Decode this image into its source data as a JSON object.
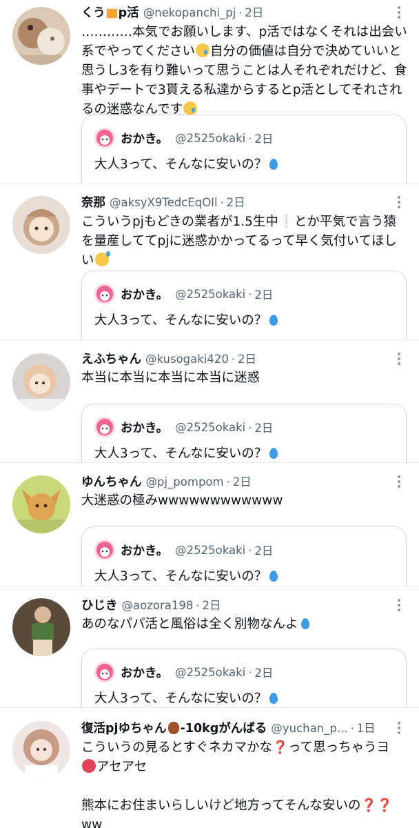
{
  "colors": {
    "text": "#0f1419",
    "secondary": "#536471",
    "divider": "#e6ecf0",
    "quote_border": "#cfd9de"
  },
  "icons": {
    "more": "more-vertical-icon",
    "drop": "droplet-emoji",
    "sad": "crying-face-emoji",
    "sweat": "grinning-sweat-emoji"
  },
  "quoted": {
    "name": "おかき。",
    "handle": "@2525okaki",
    "time": "2日",
    "text": "大人3って、そんなに安いの？"
  },
  "tweets": [
    {
      "name_a": "くう",
      "name_b": "p活",
      "handle": "@nekopanchi_pj",
      "time": "2日",
      "text_1": "…………本気でお願いします、p活ではなくそれは出会い系でやってください",
      "text_2": "自分の価値は自分で決めていいと思うし3を有り難いって思うことは人それぞれだけど、食事やデートで3貰える私達からするとp活としてそれされるの迷惑なんです"
    },
    {
      "name": "奈那",
      "handle": "@aksyX9TedcEqOIl",
      "time": "2日",
      "text_1": "こういうpjもどきの業者が1.5生中",
      "excl": "❕",
      "text_2": "とか平気で言う猿を量産しててpjに迷惑かかってるって早く気付いてほしい"
    },
    {
      "name": "えふちゃん",
      "handle": "@kusogaki420",
      "time": "2日",
      "text": "本当に本当に本当に本当に迷惑"
    },
    {
      "name": "ゆんちゃん",
      "handle": "@pj_pompom",
      "time": "2日",
      "text": "大迷惑の極みwwwwwwwwwwww"
    },
    {
      "name": "ひじき",
      "handle": "@aozora198",
      "time": "2日",
      "text": "あのなパパ活と風俗は全く別物なんよ"
    },
    {
      "name_a": "復活pjゆちゃん",
      "name_b": "-10kgがんばる",
      "handle": "@yuchan_p...",
      "time": "1日",
      "text_1": "こういうの見るとすぐネカマかな",
      "q1": "❓",
      "text_2": "って思っちゃうヨ",
      "text_3": "アセアセ",
      "text_4": "熊本にお住まいらしいけど地方ってそんな安いの",
      "q2": "❓❓",
      "text_5": "ww"
    }
  ]
}
